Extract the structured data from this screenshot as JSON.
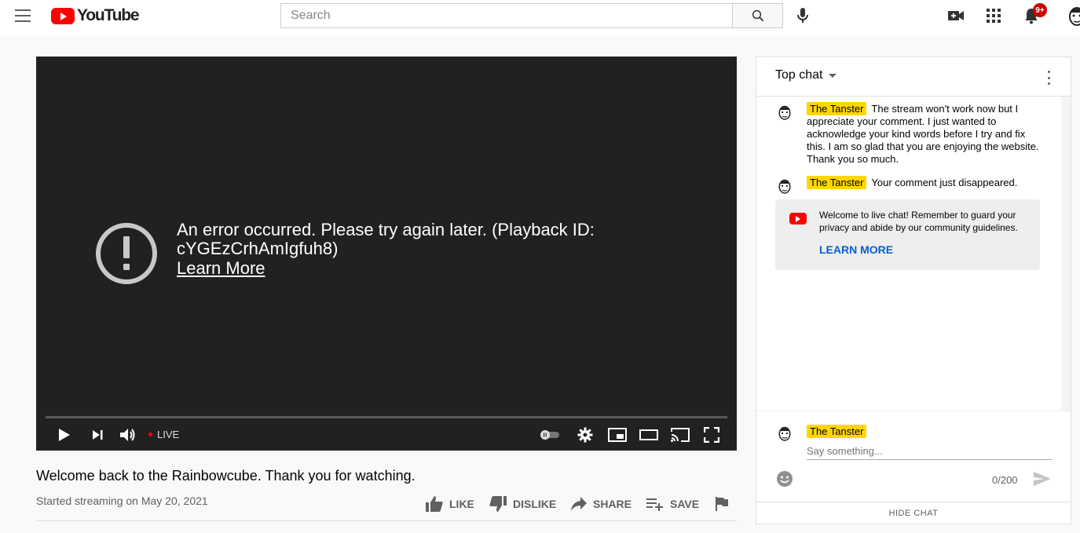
{
  "header": {
    "logo_text": "YouTube",
    "search_placeholder": "Search",
    "notifications_badge": "9+"
  },
  "player": {
    "error_message": "An error occurred. Please try again later. (Playback ID: cYGEzCrhAmIgfuh8)",
    "learn_more": "Learn More",
    "live_label": "LIVE"
  },
  "video": {
    "title": "Welcome back to the Rainbowcube. Thank you for watching.",
    "date": "Started streaming on May 20, 2021",
    "actions": {
      "like": "LIKE",
      "dislike": "DISLIKE",
      "share": "SHARE",
      "save": "SAVE"
    }
  },
  "chat": {
    "mode": "Top chat",
    "messages": [
      {
        "author": "The Tanster",
        "text": "The stream won't work now but I appreciate your comment. I just wanted to acknowledge your kind words before I try and fix this. I am so glad that you are enjoying the website. Thank you so much."
      },
      {
        "author": "The Tanster",
        "text": "Your comment just disappeared."
      }
    ],
    "welcome": {
      "text": "Welcome to live chat! Remember to guard your privacy and abide by our community guidelines.",
      "link": "LEARN MORE"
    },
    "input": {
      "author": "The Tanster",
      "placeholder": "Say something...",
      "counter": "0/200"
    },
    "hide_label": "HIDE CHAT"
  },
  "colors": {
    "brand_red": "#ff0000",
    "author_highlight": "#ffd600",
    "link_blue": "#065fd4",
    "player_bg": "#212121"
  }
}
